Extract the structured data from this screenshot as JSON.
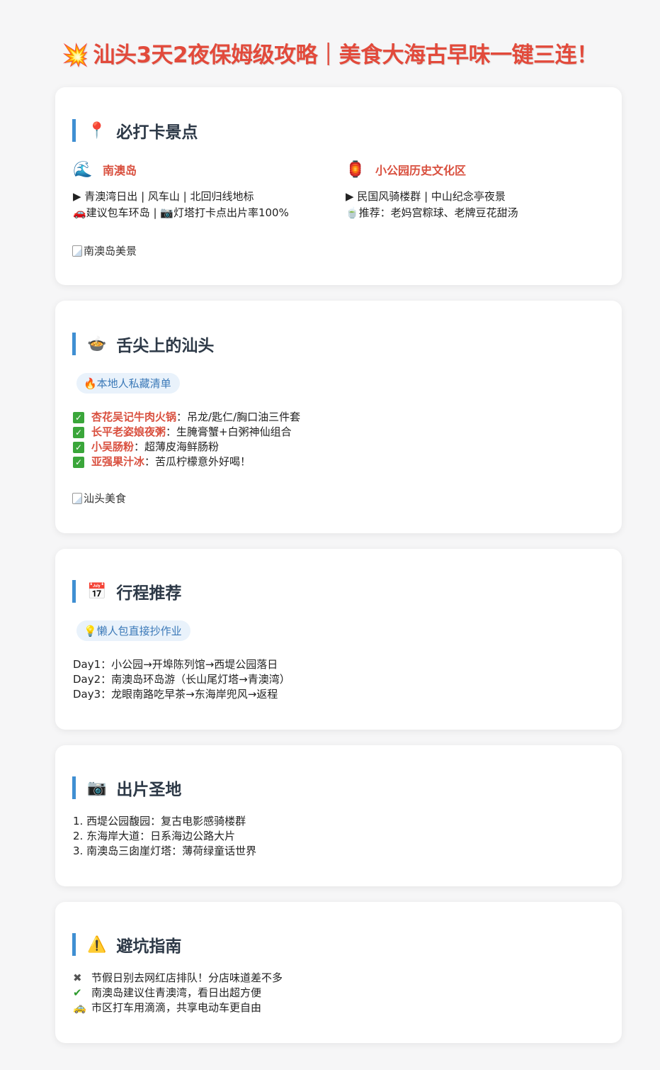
{
  "title": {
    "icon": "💥",
    "text": "汕头3天2夜保姆级攻略｜美食大海古早味一键三连！"
  },
  "sections": {
    "spots": {
      "icon": "📍",
      "heading": "必打卡景点",
      "items": [
        {
          "icon": "🌊",
          "name": "南澳岛",
          "line1": "▶ 青澳湾日出 | 风车山 | 北回归线地标",
          "line2": "🚗建议包车环岛 | 📷灯塔打卡点出片率100%"
        },
        {
          "icon": "🏮",
          "name": "小公园历史文化区",
          "line1": "▶ 民国风骑楼群 | 中山纪念亭夜景",
          "line2": "🍵推荐：老妈宫粽球、老牌豆花甜汤"
        }
      ],
      "image_alt": "南澳岛美景"
    },
    "food": {
      "icon": "🍲",
      "heading": "舌尖上的汕头",
      "tag": "🔥本地人私藏清单",
      "items": [
        {
          "name": "杏花吴记牛肉火锅",
          "desc": "：吊龙/匙仁/胸口油三件套"
        },
        {
          "name": "长平老姿娘夜粥",
          "desc": "：生腌膏蟹+白粥神仙组合"
        },
        {
          "name": "小吴肠粉",
          "desc": "：超薄皮海鲜肠粉"
        },
        {
          "name": "亚强果汁冰",
          "desc": "：苦瓜柠檬意外好喝！"
        }
      ],
      "check_glyph": "✓",
      "image_alt": "汕头美食"
    },
    "itinerary": {
      "icon": "📅",
      "heading": "行程推荐",
      "tag": "💡懒人包直接抄作业",
      "days": [
        "Day1：小公园→开埠陈列馆→西堤公园落日",
        "Day2：南澳岛环岛游（长山尾灯塔→青澳湾）",
        "Day3：龙眼南路吃早茶→东海岸兜风→返程"
      ]
    },
    "photo": {
      "icon": "📷",
      "heading": "出片圣地",
      "items": [
        "1. 西堤公园馥园：复古电影感骑楼群",
        "2. 东海岸大道：日系海边公路大片",
        "3. 南澳岛三囱崖灯塔：薄荷绿童话世界"
      ]
    },
    "tips": {
      "icon": "⚠️",
      "heading": "避坑指南",
      "items": [
        {
          "icon": "✖",
          "color": "#555555",
          "text": "节假日别去网红店排队！分店味道差不多"
        },
        {
          "icon": "✔",
          "color": "#2e9b2e",
          "text": "南澳岛建议住青澳湾，看日出超方便"
        },
        {
          "icon": "🚕",
          "color": "#e0a020",
          "text": "市区打车用滴滴，共享电动车更自由"
        }
      ]
    }
  },
  "colors": {
    "accent": "#e24a3b",
    "heading_bar": "#3f8fd2",
    "tag_bg": "#e9f2fb",
    "tag_text": "#3b79b8"
  }
}
